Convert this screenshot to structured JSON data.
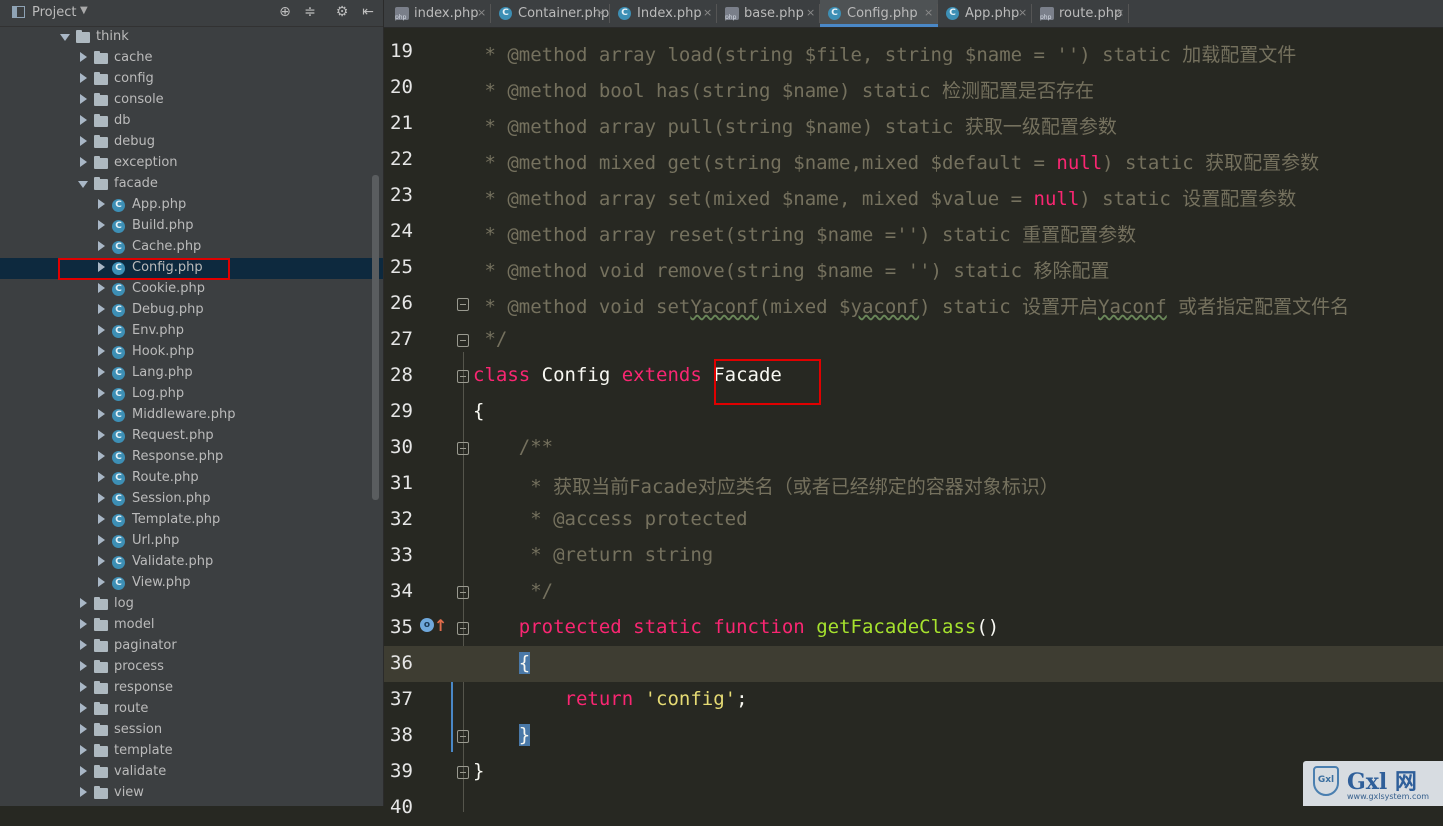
{
  "sidebar": {
    "title": "Project",
    "tree": [
      {
        "label": "think",
        "type": "folder",
        "depth": 0,
        "expanded": true
      },
      {
        "label": "cache",
        "type": "folder",
        "depth": 1,
        "expanded": false
      },
      {
        "label": "config",
        "type": "folder",
        "depth": 1,
        "expanded": false
      },
      {
        "label": "console",
        "type": "folder",
        "depth": 1,
        "expanded": false
      },
      {
        "label": "db",
        "type": "folder",
        "depth": 1,
        "expanded": false
      },
      {
        "label": "debug",
        "type": "folder",
        "depth": 1,
        "expanded": false
      },
      {
        "label": "exception",
        "type": "folder",
        "depth": 1,
        "expanded": false
      },
      {
        "label": "facade",
        "type": "folder",
        "depth": 1,
        "expanded": true
      },
      {
        "label": "App.php",
        "type": "class",
        "depth": 2
      },
      {
        "label": "Build.php",
        "type": "class",
        "depth": 2
      },
      {
        "label": "Cache.php",
        "type": "class",
        "depth": 2
      },
      {
        "label": "Config.php",
        "type": "class",
        "depth": 2,
        "selected": true
      },
      {
        "label": "Cookie.php",
        "type": "class",
        "depth": 2
      },
      {
        "label": "Debug.php",
        "type": "class",
        "depth": 2
      },
      {
        "label": "Env.php",
        "type": "class",
        "depth": 2
      },
      {
        "label": "Hook.php",
        "type": "class",
        "depth": 2
      },
      {
        "label": "Lang.php",
        "type": "class",
        "depth": 2
      },
      {
        "label": "Log.php",
        "type": "class",
        "depth": 2
      },
      {
        "label": "Middleware.php",
        "type": "class",
        "depth": 2
      },
      {
        "label": "Request.php",
        "type": "class",
        "depth": 2
      },
      {
        "label": "Response.php",
        "type": "class",
        "depth": 2
      },
      {
        "label": "Route.php",
        "type": "class",
        "depth": 2
      },
      {
        "label": "Session.php",
        "type": "class",
        "depth": 2
      },
      {
        "label": "Template.php",
        "type": "class",
        "depth": 2
      },
      {
        "label": "Url.php",
        "type": "class",
        "depth": 2
      },
      {
        "label": "Validate.php",
        "type": "class",
        "depth": 2
      },
      {
        "label": "View.php",
        "type": "class",
        "depth": 2
      },
      {
        "label": "log",
        "type": "folder",
        "depth": 1,
        "expanded": false
      },
      {
        "label": "model",
        "type": "folder",
        "depth": 1,
        "expanded": false
      },
      {
        "label": "paginator",
        "type": "folder",
        "depth": 1,
        "expanded": false
      },
      {
        "label": "process",
        "type": "folder",
        "depth": 1,
        "expanded": false
      },
      {
        "label": "response",
        "type": "folder",
        "depth": 1,
        "expanded": false
      },
      {
        "label": "route",
        "type": "folder",
        "depth": 1,
        "expanded": false
      },
      {
        "label": "session",
        "type": "folder",
        "depth": 1,
        "expanded": false
      },
      {
        "label": "template",
        "type": "folder",
        "depth": 1,
        "expanded": false
      },
      {
        "label": "validate",
        "type": "folder",
        "depth": 1,
        "expanded": false
      },
      {
        "label": "view",
        "type": "folder",
        "depth": 1,
        "expanded": false
      }
    ]
  },
  "tabs": [
    {
      "label": "index.php",
      "icon": "php-file-icon",
      "active": false
    },
    {
      "label": "Container.php",
      "icon": "class-icon",
      "active": false
    },
    {
      "label": "Index.php",
      "icon": "class-icon",
      "active": false
    },
    {
      "label": "base.php",
      "icon": "php-file-icon",
      "active": false
    },
    {
      "label": "Config.php",
      "icon": "class-icon",
      "active": true
    },
    {
      "label": "App.php",
      "icon": "class-icon",
      "active": false
    },
    {
      "label": "route.php",
      "icon": "php-file-icon",
      "active": false
    }
  ],
  "editor": {
    "lines": [
      {
        "num": "19",
        "tokens": [
          [
            "c-com",
            " * @method array load(string $file, string $name = '') static 加载配置文件"
          ]
        ]
      },
      {
        "num": "20",
        "tokens": [
          [
            "c-com",
            " * @method bool has(string $name) static 检测配置是否存在"
          ]
        ]
      },
      {
        "num": "21",
        "tokens": [
          [
            "c-com",
            " * @method array pull(string $name) static 获取一级配置参数"
          ]
        ]
      },
      {
        "num": "22",
        "tokens": [
          [
            "c-com",
            " * @method mixed get(string $name,mixed $default = "
          ],
          [
            "c-kw",
            "null"
          ],
          [
            "c-com",
            ") static 获取配置参数"
          ]
        ]
      },
      {
        "num": "23",
        "tokens": [
          [
            "c-com",
            " * @method array set(mixed $name, mixed $value = "
          ],
          [
            "c-kw",
            "null"
          ],
          [
            "c-com",
            ") static 设置配置参数"
          ]
        ]
      },
      {
        "num": "24",
        "tokens": [
          [
            "c-com",
            " * @method array reset(string $name ='') static 重置配置参数"
          ]
        ]
      },
      {
        "num": "25",
        "tokens": [
          [
            "c-com",
            " * @method void remove(string $name = '') static 移除配置"
          ]
        ]
      },
      {
        "num": "26",
        "tokens": [
          [
            "c-com",
            " * @method void set"
          ],
          [
            "c-com wavy",
            "Yaconf"
          ],
          [
            "c-com",
            "(mixed $"
          ],
          [
            "c-com wavy",
            "yaconf"
          ],
          [
            "c-com",
            ") static 设置开启"
          ],
          [
            "c-com wavy",
            "Yaconf"
          ],
          [
            "c-com",
            " 或者指定配置文件名"
          ]
        ],
        "fold": true
      },
      {
        "num": "27",
        "tokens": [
          [
            "c-com",
            " */"
          ]
        ],
        "fold": true
      },
      {
        "num": "28",
        "tokens": [
          [
            "c-kw",
            "class"
          ],
          [
            "c-txt",
            " Config "
          ],
          [
            "c-kw",
            "extends"
          ],
          [
            "c-txt",
            " Facade"
          ]
        ],
        "fold": true
      },
      {
        "num": "29",
        "tokens": [
          [
            "c-txt",
            "{"
          ]
        ]
      },
      {
        "num": "30",
        "tokens": [
          [
            "c-com",
            "    /**"
          ]
        ],
        "fold": true
      },
      {
        "num": "31",
        "tokens": [
          [
            "c-com",
            "     * 获取当前Facade对应类名（或者已经绑定的容器对象标识）"
          ]
        ]
      },
      {
        "num": "32",
        "tokens": [
          [
            "c-com",
            "     * @access protected"
          ]
        ]
      },
      {
        "num": "33",
        "tokens": [
          [
            "c-com",
            "     * @return string"
          ]
        ]
      },
      {
        "num": "34",
        "tokens": [
          [
            "c-com",
            "     */"
          ]
        ],
        "fold": true
      },
      {
        "num": "35",
        "tokens": [
          [
            "c-txt",
            "    "
          ],
          [
            "c-kw",
            "protected static function"
          ],
          [
            "c-txt",
            " "
          ],
          [
            "c-fn",
            "getFacadeClass"
          ],
          [
            "c-txt",
            "()"
          ]
        ],
        "fold": true,
        "impl": true
      },
      {
        "num": "36",
        "tokens": [
          [
            "c-txt",
            "    "
          ],
          [
            "brace-hl",
            "{"
          ]
        ],
        "current": true
      },
      {
        "num": "37",
        "tokens": [
          [
            "c-txt",
            "        "
          ],
          [
            "c-kw",
            "return"
          ],
          [
            "c-txt",
            " "
          ],
          [
            "c-str",
            "'config'"
          ],
          [
            "c-txt",
            ";"
          ]
        ]
      },
      {
        "num": "38",
        "tokens": [
          [
            "c-txt",
            "    "
          ],
          [
            "brace-hl",
            "}"
          ]
        ],
        "fold": true
      },
      {
        "num": "39",
        "tokens": [
          [
            "c-txt",
            "}"
          ]
        ],
        "fold": true
      },
      {
        "num": "40",
        "tokens": []
      }
    ]
  },
  "watermark": {
    "shield": "Gxl",
    "brand": "Gxl 网",
    "site": "www.gxlsystem.com"
  },
  "colors": {
    "highlight_box": "#e00000",
    "keyword": "#f92672",
    "comment": "#75715e",
    "function": "#a6e22e",
    "string": "#e6db74"
  }
}
